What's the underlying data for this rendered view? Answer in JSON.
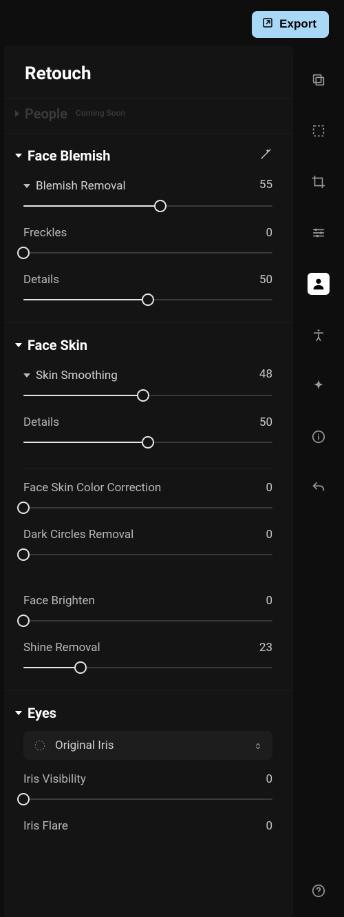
{
  "topbar": {
    "export_label": "Export"
  },
  "panel_title": "Retouch",
  "people": {
    "label": "People",
    "badge": "Coming Soon"
  },
  "sections": {
    "face_blemish": {
      "title": "Face Blemish",
      "blemish_removal": {
        "label": "Blemish Removal",
        "value": 55
      },
      "freckles": {
        "label": "Freckles",
        "value": 0
      },
      "details": {
        "label": "Details",
        "value": 50
      }
    },
    "face_skin": {
      "title": "Face Skin",
      "skin_smoothing": {
        "label": "Skin Smoothing",
        "value": 48
      },
      "details": {
        "label": "Details",
        "value": 50
      },
      "color_correction": {
        "label": "Face Skin Color Correction",
        "value": 0
      },
      "dark_circles": {
        "label": "Dark Circles Removal",
        "value": 0
      },
      "face_brighten": {
        "label": "Face Brighten",
        "value": 0
      },
      "shine_removal": {
        "label": "Shine Removal",
        "value": 23
      }
    },
    "eyes": {
      "title": "Eyes",
      "iris_dropdown": {
        "label": "Original Iris"
      },
      "iris_visibility": {
        "label": "Iris Visibility",
        "value": 0
      },
      "iris_flare": {
        "label": "Iris Flare",
        "value": 0
      }
    }
  },
  "rail": {
    "compare": "compare-icon",
    "selection": "selection-icon",
    "crop": "crop-icon",
    "adjust": "adjust-icon",
    "person": "person-icon",
    "body": "body-icon",
    "sparkle": "sparkle-icon",
    "info": "info-icon",
    "undo": "undo-icon",
    "help": "help-icon"
  }
}
